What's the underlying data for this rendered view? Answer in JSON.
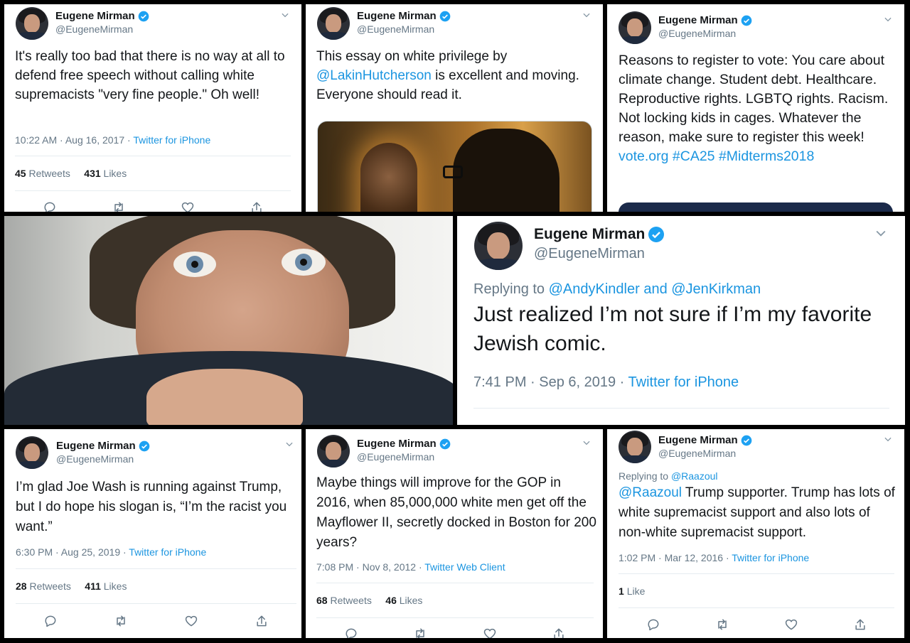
{
  "author": {
    "name": "Eugene Mirman",
    "handle": "@EugeneMirman"
  },
  "tweets": [
    {
      "text": "It's really too bad that there is no way at all to defend free speech without calling white supremacists \"very fine people.\" Oh well!",
      "time": "10:22 AM · Aug 16, 2017 · ",
      "source": "Twitter for iPhone",
      "retweets": "45",
      "retweets_label": "Retweets",
      "likes": "431",
      "likes_label": "Likes"
    },
    {
      "text_before": "This essay on white privilege by ",
      "mention": "@LakinHutcherson",
      "text_after": " is excellent and moving. Everyone should read it."
    },
    {
      "text": "Reasons to register to vote: You care about climate change. Student debt. Healthcare. Reproductive rights. LGBTQ rights. Racism. Not locking kids in cages. Whatever the reason, make sure to register this week! ",
      "link1": "vote.org",
      "tag1": "#CA25",
      "tag2": "#Midterms2018"
    },
    {
      "replying_label": "Replying to ",
      "replying_users": "@AndyKindler and @JenKirkman",
      "text": "Just realized I’m not sure if I’m my favorite Jewish comic.",
      "time": "7:41 PM · Sep 6, 2019 · ",
      "source": "Twitter for iPhone"
    },
    {
      "text": "I’m glad Joe Wash is running against Trump, but I do hope his slogan is, “I’m the racist you want.”",
      "time": "6:30 PM · Aug 25, 2019 · ",
      "source": "Twitter for iPhone",
      "retweets": "28",
      "retweets_label": "Retweets",
      "likes": "411",
      "likes_label": "Likes"
    },
    {
      "text": "Maybe things will improve for the GOP in 2016, when 85,000,000 white men get off the Mayflower II, secretly docked in Boston for 200 years?",
      "time": "7:08 PM · Nov 8, 2012 · ",
      "source": "Twitter Web Client",
      "retweets": "68",
      "retweets_label": "Retweets",
      "likes": "46",
      "likes_label": "Likes"
    },
    {
      "replying_label": "Replying to ",
      "replying_users": "@Raazoul",
      "mention": "@Raazoul",
      "text": " Trump supporter. Trump has lots of white supremacist support and also lots of non-white supremacist support.",
      "time": "1:02 PM · Mar 12, 2016 · ",
      "source": "Twitter for iPhone",
      "likes": "1",
      "likes_label": "Like"
    }
  ],
  "colors": {
    "link": "#1b95e0",
    "verified": "#1da1f2",
    "meta": "#657786",
    "text": "#14171a"
  },
  "icons": [
    "verified-badge-icon",
    "chevron-down-icon",
    "reply-icon",
    "retweet-icon",
    "like-icon",
    "share-icon"
  ]
}
